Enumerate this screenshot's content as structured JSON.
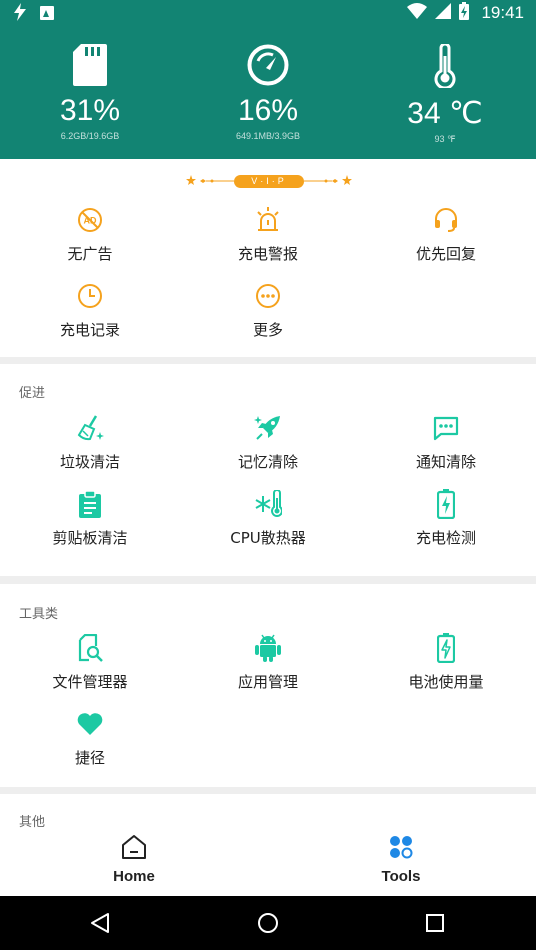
{
  "status_bar": {
    "time": "19:41"
  },
  "header": {
    "stats": [
      {
        "icon": "sd-card-icon",
        "value": "31%",
        "sub": "6.2GB/19.6GB"
      },
      {
        "icon": "speedometer-icon",
        "value": "16%",
        "sub": "649.1MB/3.9GB"
      },
      {
        "icon": "thermometer-icon",
        "value": "34 ℃",
        "sub": "93 ℉"
      }
    ]
  },
  "vip": {
    "badge": "V·I·P"
  },
  "vip_items": [
    {
      "icon": "no-ads-icon",
      "label": "无广告"
    },
    {
      "icon": "charge-alarm-icon",
      "label": "充电警报"
    },
    {
      "icon": "headset-icon",
      "label": "优先回复"
    },
    {
      "icon": "clock-icon",
      "label": "充电记录"
    },
    {
      "icon": "more-icon",
      "label": "更多"
    }
  ],
  "boost": {
    "title": "促进",
    "items": [
      {
        "icon": "broom-icon",
        "label": "垃圾清洁"
      },
      {
        "icon": "rocket-icon",
        "label": "记忆清除"
      },
      {
        "icon": "message-icon",
        "label": "通知清除"
      },
      {
        "icon": "clipboard-icon",
        "label": "剪贴板清洁"
      },
      {
        "icon": "cpu-cooler-icon",
        "label": "CPU散热器"
      },
      {
        "icon": "battery-charging-icon",
        "label": "充电检测"
      }
    ]
  },
  "tools": {
    "title": "工具类",
    "items": [
      {
        "icon": "file-search-icon",
        "label": "文件管理器"
      },
      {
        "icon": "android-icon",
        "label": "应用管理"
      },
      {
        "icon": "battery-usage-icon",
        "label": "电池使用量"
      },
      {
        "icon": "heart-icon",
        "label": "捷径"
      }
    ]
  },
  "other": {
    "title": "其他"
  },
  "bottom_nav": {
    "home": "Home",
    "tools": "Tools"
  },
  "colors": {
    "header": "#128473",
    "accent_teal": "#1cc9a3",
    "vip_orange": "#f5a21d",
    "nav_blue": "#1e88e5"
  }
}
